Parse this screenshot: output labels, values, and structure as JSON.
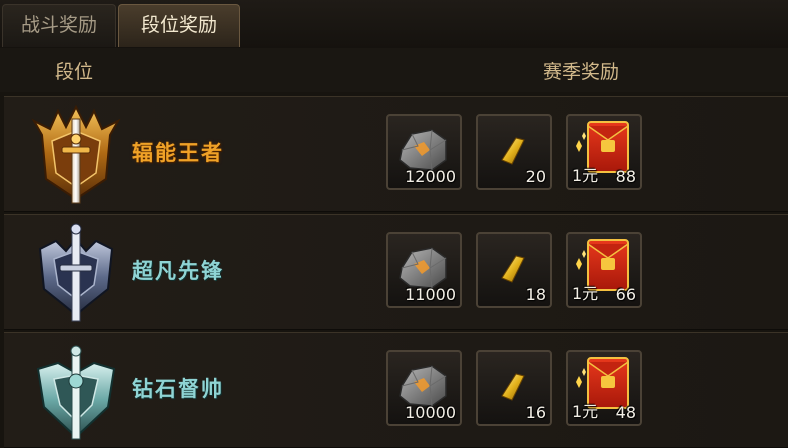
{
  "tabs": [
    {
      "label": "战斗奖励",
      "active": false
    },
    {
      "label": "段位奖励",
      "active": true
    }
  ],
  "header": {
    "rank": "段位",
    "season_reward": "赛季奖励"
  },
  "tiers": [
    {
      "name": "辐能王者",
      "badge": "gold-crowned-sword-badge-icon",
      "rewards": {
        "ore": "12000",
        "gold_bar": "20",
        "envelope_amount": "88",
        "envelope_label": "1元"
      }
    },
    {
      "name": "超凡先锋",
      "badge": "steel-sword-badge-icon",
      "rewards": {
        "ore": "11000",
        "gold_bar": "18",
        "envelope_amount": "66",
        "envelope_label": "1元"
      }
    },
    {
      "name": "钻石督帅",
      "badge": "diamond-shield-badge-icon",
      "rewards": {
        "ore": "10000",
        "gold_bar": "16",
        "envelope_amount": "48",
        "envelope_label": "1元"
      }
    }
  ],
  "colors": {
    "gold_text": "#f0a227",
    "cyan_text": "#8fd4d4",
    "header_text": "#d2b98b"
  }
}
